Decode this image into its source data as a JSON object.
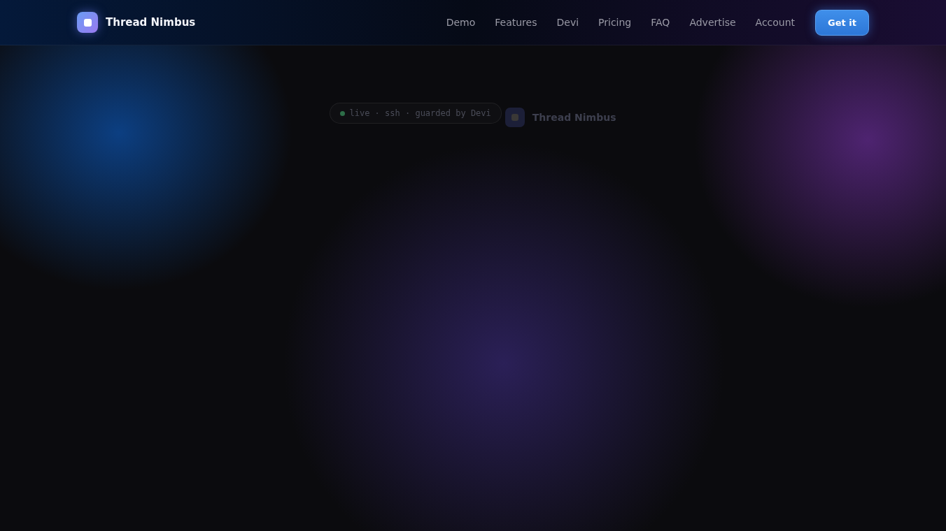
{
  "header": {
    "brand": "Thread Nimbus",
    "nav": [
      {
        "label": "Demo"
      },
      {
        "label": "Features"
      },
      {
        "label": "Devi"
      },
      {
        "label": "Pricing"
      },
      {
        "label": "FAQ"
      },
      {
        "label": "Advertise"
      },
      {
        "label": "Account"
      }
    ],
    "cta": "Get it"
  },
  "hero": {
    "status_pill": "live · ssh · guarded by Devi",
    "brand": "Thread Nimbus"
  }
}
